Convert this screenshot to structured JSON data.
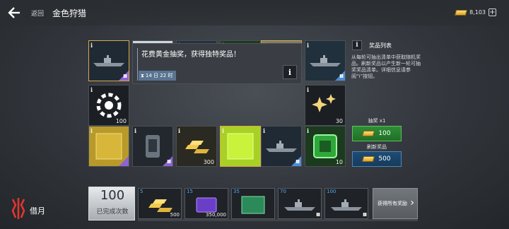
{
  "header": {
    "back_label": "返回",
    "title": "金色狩猎",
    "currency_amount": "8,103"
  },
  "grid": {
    "tiles": [
      {
        "icon": "warship-icon",
        "tier": "III",
        "qty": "",
        "rarity": "purple"
      },
      {
        "icon": "camo-pattern-icon",
        "tier": "",
        "qty": "",
        "rarity": ""
      },
      {
        "icon": "fighter-jet-icon",
        "tier": "III",
        "qty": "",
        "rarity": "blue"
      },
      {
        "icon": "green-crate-icon",
        "tier": "",
        "qty": "100",
        "rarity": ""
      },
      {
        "icon": "plate-camo-icon",
        "tier": "",
        "qty": "",
        "rarity": "orange"
      },
      {
        "icon": "destroyer-icon",
        "tier": "III",
        "qty": "",
        "rarity": "blue"
      },
      {
        "icon": "commander-emblem-icon",
        "tier": "",
        "qty": "100",
        "rarity": ""
      },
      {
        "icon": "sparkle-stars-icon",
        "tier": "",
        "qty": "30",
        "rarity": ""
      },
      {
        "icon": "gold-plate-icon",
        "tier": "",
        "qty": "",
        "rarity": "purple"
      },
      {
        "icon": "armor-module-icon",
        "tier": "III",
        "qty": "",
        "rarity": "purple"
      },
      {
        "icon": "gold-bars-icon",
        "tier": "",
        "qty": "300",
        "rarity": ""
      },
      {
        "icon": "lime-plate-icon",
        "tier": "",
        "qty": "",
        "rarity": ""
      },
      {
        "icon": "submarine-icon",
        "tier": "III",
        "qty": "",
        "rarity": "blue"
      },
      {
        "icon": "green-crate-icon",
        "tier": "",
        "qty": "10",
        "rarity": ""
      }
    ],
    "banner_text": "花费黄金抽奖，获得独特奖品！",
    "banner_timer": "14 日 22 时"
  },
  "side": {
    "reward_title": "奖品列表",
    "reward_desc": "从每轮可抽出清单中获取随机奖品。刷新奖品以产生新一轮可抽奖奖品清单。详细信息请参阅“i”按钮。",
    "draw_label": "抽奖 x1",
    "draw_cost": "100",
    "refresh_label": "刷新奖品",
    "refresh_cost": "500"
  },
  "bottom": {
    "user_name": "借月",
    "completed_count": "100",
    "completed_label": "已完成次数",
    "claim_all_label": "获得所有奖励",
    "milestones": [
      {
        "level": "5",
        "amount": "500",
        "tier": "",
        "icon": "gold-bars-icon"
      },
      {
        "level": "15",
        "amount": "350,000",
        "tier": "",
        "icon": "credits-icon"
      },
      {
        "level": "35",
        "amount": "",
        "tier": "",
        "icon": "circuit-camo-icon"
      },
      {
        "level": "70",
        "amount": "",
        "tier": "III",
        "icon": "battleship-icon"
      },
      {
        "level": "100",
        "amount": "",
        "tier": "III",
        "icon": "battleship-icon"
      }
    ]
  }
}
